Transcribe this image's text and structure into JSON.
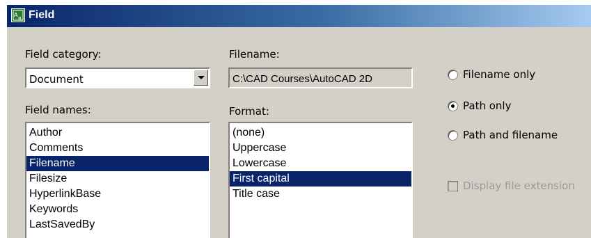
{
  "window": {
    "title": "Field",
    "icon": "field-icon"
  },
  "field_category": {
    "label": "Field category:",
    "selected": "Document"
  },
  "field_names": {
    "label": "Field names:",
    "items": [
      "Author",
      "Comments",
      "Filename",
      "Filesize",
      "HyperlinkBase",
      "Keywords",
      "LastSavedBy"
    ],
    "selected_index": 2
  },
  "filename": {
    "label": "Filename:",
    "value": "C:\\CAD Courses\\AutoCAD 2D"
  },
  "format": {
    "label": "Format:",
    "items": [
      "(none)",
      "Uppercase",
      "Lowercase",
      "First capital",
      "Title case"
    ],
    "selected_index": 3
  },
  "options": {
    "filename_only": "Filename only",
    "path_only": "Path only",
    "path_and_filename": "Path and filename",
    "selected": "path_only",
    "display_extension": "Display file extension"
  },
  "colors": {
    "selection": "#0a246a",
    "dialog_bg": "#d4d0c8"
  }
}
